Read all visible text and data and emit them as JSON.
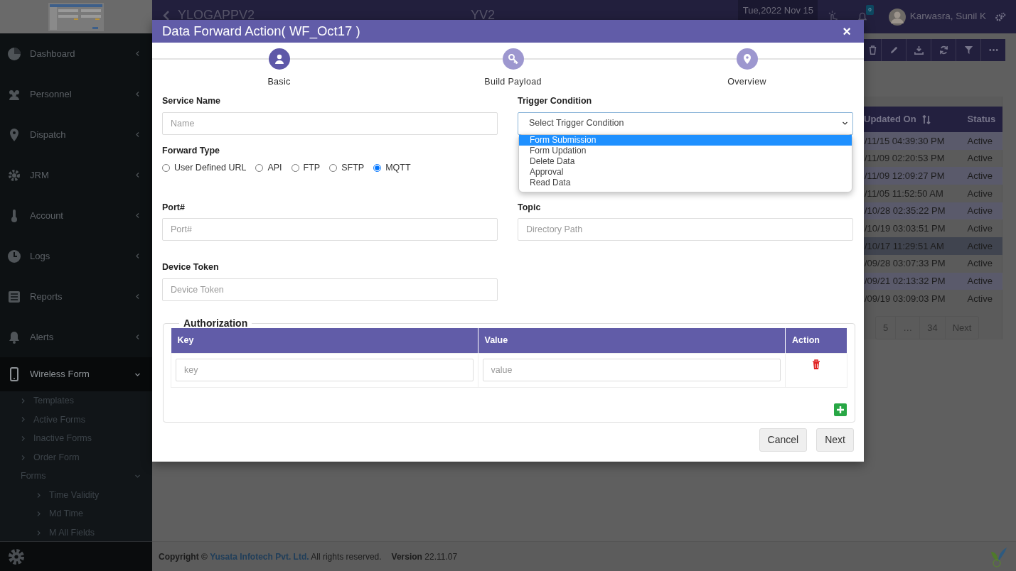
{
  "sidebar": {
    "items": [
      {
        "label": "Dashboard",
        "expanded": false
      },
      {
        "label": "Personnel",
        "expanded": false
      },
      {
        "label": "Dispatch",
        "expanded": false
      },
      {
        "label": "JRM",
        "expanded": false
      },
      {
        "label": "Account",
        "expanded": false
      },
      {
        "label": "Logs",
        "expanded": false
      },
      {
        "label": "Reports",
        "expanded": false
      },
      {
        "label": "Alerts",
        "expanded": false
      },
      {
        "label": "Wireless Form",
        "expanded": true,
        "children": [
          {
            "label": "Templates"
          },
          {
            "label": "Active Forms"
          },
          {
            "label": "Inactive Forms"
          },
          {
            "label": "Order Form"
          },
          {
            "label": "Forms",
            "expanded": true,
            "children": [
              {
                "label": "Time Validity"
              },
              {
                "label": "Md Time"
              },
              {
                "label": "M All Fields"
              }
            ]
          }
        ]
      }
    ]
  },
  "topbar": {
    "app_title": "YLOGAPPV2",
    "center_title": "YV2",
    "date": "Tue,2022 Nov 15",
    "notification_count": "0",
    "user_name": "Karwasra, Sunil K"
  },
  "table": {
    "columns": [
      "Updated On",
      "Status"
    ],
    "rows": [
      {
        "updated": "/11/15 04:39:30 PM",
        "status": "Active",
        "selected": false
      },
      {
        "updated": "/11/09 02:20:53 PM",
        "status": "Active",
        "selected": false
      },
      {
        "updated": "/11/09 12:09:27 PM",
        "status": "Active",
        "selected": false
      },
      {
        "updated": "/11/05 11:52:50 AM",
        "status": "Active",
        "selected": false
      },
      {
        "updated": "/10/28 02:35:22 PM",
        "status": "Active",
        "selected": false
      },
      {
        "updated": "/10/19 03:03:51 PM",
        "status": "Active",
        "selected": false
      },
      {
        "updated": "/10/17 11:29:51 AM",
        "status": "Active",
        "selected": true
      },
      {
        "updated": "/09/28 03:07:33 PM",
        "status": "Active",
        "selected": false
      },
      {
        "updated": "/09/21 02:13:32 PM",
        "status": "Active",
        "selected": false
      },
      {
        "updated": "/09/19 03:09:03 PM",
        "status": "Active",
        "selected": false
      }
    ],
    "pagination": [
      "5",
      "…",
      "34",
      "Next"
    ]
  },
  "modal": {
    "title": "Data Forward Action( WF_Oct17 )",
    "close": "×",
    "steps": [
      {
        "label": "Basic",
        "selected": true
      },
      {
        "label": "Build Payload",
        "selected": false
      },
      {
        "label": "Overview",
        "selected": false
      }
    ],
    "form_rows": [
      {
        "cells": [
          {
            "kind": "text",
            "label": "Service Name",
            "placeholder": "Name"
          },
          {
            "kind": "select",
            "label": "Trigger Condition",
            "value": "Select Trigger Condition",
            "expanded": true,
            "options": [
              {
                "label": "Form Submission",
                "selected": true
              },
              {
                "label": "Form Updation",
                "selected": false
              },
              {
                "label": "Delete Data",
                "selected": false
              },
              {
                "label": "Approval",
                "selected": false
              },
              {
                "label": "Read Data",
                "selected": false
              }
            ]
          }
        ]
      },
      {
        "cells": [
          {
            "kind": "radios",
            "label": "Forward Type",
            "options": [
              {
                "label": "User Defined URL",
                "selected": false
              },
              {
                "label": "API",
                "selected": false
              },
              {
                "label": "FTP",
                "selected": false
              },
              {
                "label": "SFTP",
                "selected": false
              },
              {
                "label": "MQTT",
                "selected": true
              }
            ]
          }
        ]
      },
      {
        "cells": [
          {
            "kind": "text",
            "label": "Port#",
            "placeholder": "Port#"
          },
          {
            "kind": "text",
            "label": "Topic",
            "placeholder": "Directory Path"
          }
        ]
      },
      {
        "cells": [
          {
            "kind": "text",
            "label": "Device Token",
            "placeholder": "Device Token"
          }
        ]
      }
    ],
    "authorization": {
      "legend": "Authorization",
      "columns": [
        "Key",
        "Value",
        "Action"
      ],
      "rows": [
        {
          "key_placeholder": "key",
          "value_placeholder": "value"
        }
      ]
    },
    "buttons": [
      "Cancel",
      "Next"
    ]
  },
  "footer": {
    "copyright_prefix": "**Copyright ©**",
    "company_link": "Yusata Infotech Pvt. Ltd.",
    "copyright_suffix": "All rights reserved.",
    "version": "**Version** 22.11.07"
  }
}
